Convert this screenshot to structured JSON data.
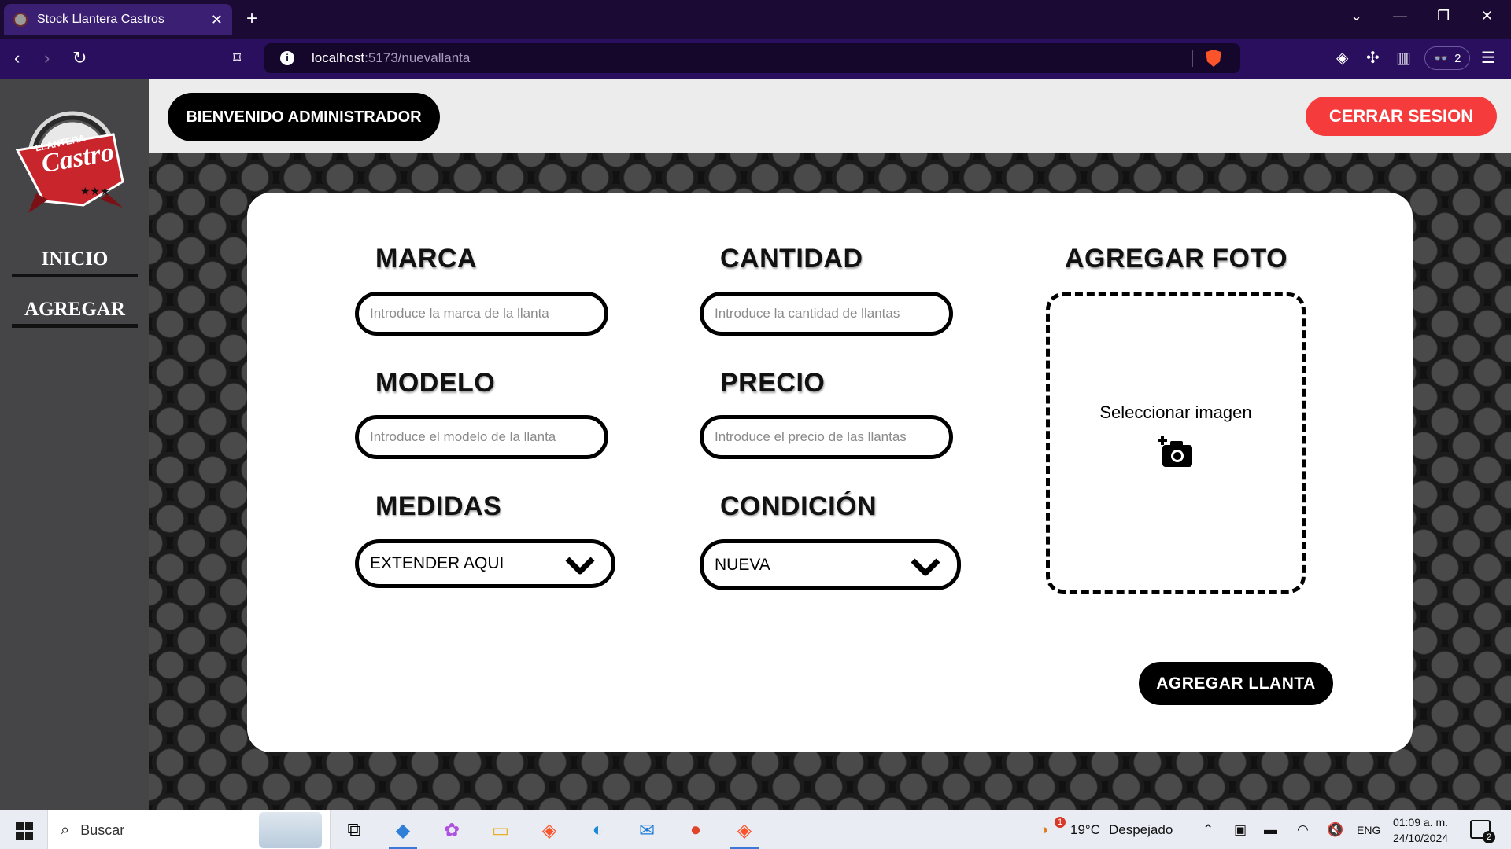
{
  "browser": {
    "tab_title": "Stock Llantera Castros",
    "tab_close": "✕",
    "new_tab": "+",
    "url_host": "localhost",
    "url_path": ":5173/nuevallanta",
    "profile_count": "2"
  },
  "sidebar": {
    "logo_text_top": "LLANTERA",
    "logo_text_main": "Castro",
    "items": [
      {
        "label": "INICIO"
      },
      {
        "label": "AGREGAR"
      }
    ]
  },
  "header": {
    "welcome_label": "BIENVENIDO ADMINISTRADOR",
    "logout_label": "CERRAR SESION"
  },
  "form": {
    "marca": {
      "label": "MARCA",
      "placeholder": "Introduce la marca de la llanta"
    },
    "cantidad": {
      "label": "CANTIDAD",
      "placeholder": "Introduce la cantidad de llantas"
    },
    "modelo": {
      "label": "MODELO",
      "placeholder": "Introduce el modelo de la llanta"
    },
    "precio": {
      "label": "PRECIO",
      "placeholder": "Introduce el precio de las llantas"
    },
    "medidas": {
      "label": "MEDIDAS",
      "selected": "EXTENDER AQUI"
    },
    "condicion": {
      "label": "CONDICIÓN",
      "selected": "NUEVA"
    },
    "foto": {
      "label": "AGREGAR FOTO",
      "select_text": "Seleccionar imagen",
      "icon": "camera-add-icon"
    },
    "submit_label": "AGREGAR LLANTA"
  },
  "taskbar": {
    "search_text": "Buscar",
    "weather_temp": "19°C",
    "weather_text": "Despejado",
    "weather_alert": "1",
    "language": "ENG",
    "time": "01:09 a. m.",
    "date": "24/10/2024",
    "notification_count": "2"
  },
  "colors": {
    "logout_bg": "#f53b3b",
    "browser_chrome": "#2a0f5e",
    "sidebar_bg": "#454547"
  }
}
